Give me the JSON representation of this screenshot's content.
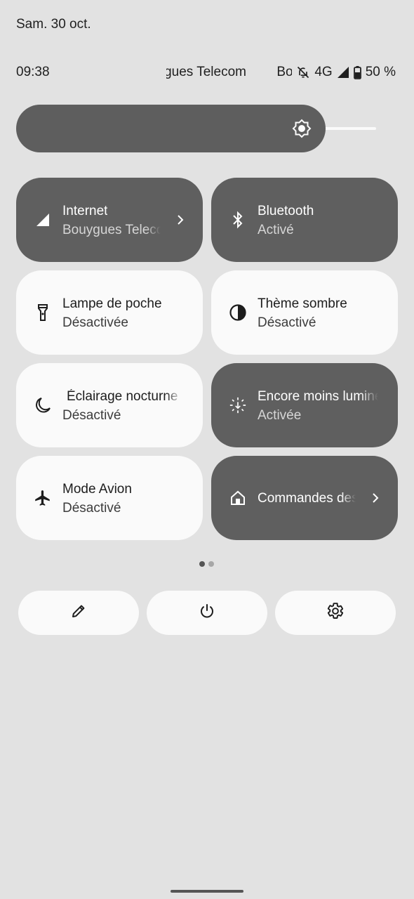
{
  "date": "Sam. 30 oct.",
  "status": {
    "time": "09:38",
    "carrier": "Bouygues Telecom",
    "operator_short": "Bouygues",
    "network": "4G",
    "battery": "50 %",
    "icons": [
      "bell-off-icon",
      "signal-icon",
      "battery-icon"
    ]
  },
  "brightness": {
    "level_percent": 82,
    "icon": "brightness-sun-icon"
  },
  "tiles": [
    {
      "title": "Internet",
      "subtitle": "Bouygues Telecom",
      "icon": "cell-signal-icon",
      "state": "on",
      "chevron": true
    },
    {
      "title": "Bluetooth",
      "subtitle": "Activé",
      "icon": "bluetooth-icon",
      "state": "on"
    },
    {
      "title": "Lampe de poche",
      "subtitle": "Désactivée",
      "icon": "flashlight-icon",
      "state": "off"
    },
    {
      "title": "Thème sombre",
      "subtitle": "Désactivé",
      "icon": "dark-theme-icon",
      "state": "off"
    },
    {
      "title": "Éclairage nocturne",
      "subtitle": "Désactivé",
      "icon": "moon-icon",
      "state": "off"
    },
    {
      "title": "Encore moins lumineux",
      "subtitle": "Activée",
      "icon": "extra-dim-icon",
      "state": "on"
    },
    {
      "title": "Mode Avion",
      "subtitle": "Désactivé",
      "icon": "airplane-icon",
      "state": "off"
    },
    {
      "title": "Commandes des appareils",
      "subtitle": "",
      "icon": "home-icon",
      "state": "on",
      "chevron": true
    }
  ],
  "pager": {
    "current": 1,
    "total": 2
  },
  "actions": [
    {
      "name": "edit",
      "icon": "pencil-icon"
    },
    {
      "name": "power",
      "icon": "power-icon"
    },
    {
      "name": "settings",
      "icon": "gear-icon"
    }
  ],
  "colors": {
    "background": "#e2e2e2",
    "tile_active": "#5f5f5f",
    "tile_inactive": "#fafafa"
  }
}
